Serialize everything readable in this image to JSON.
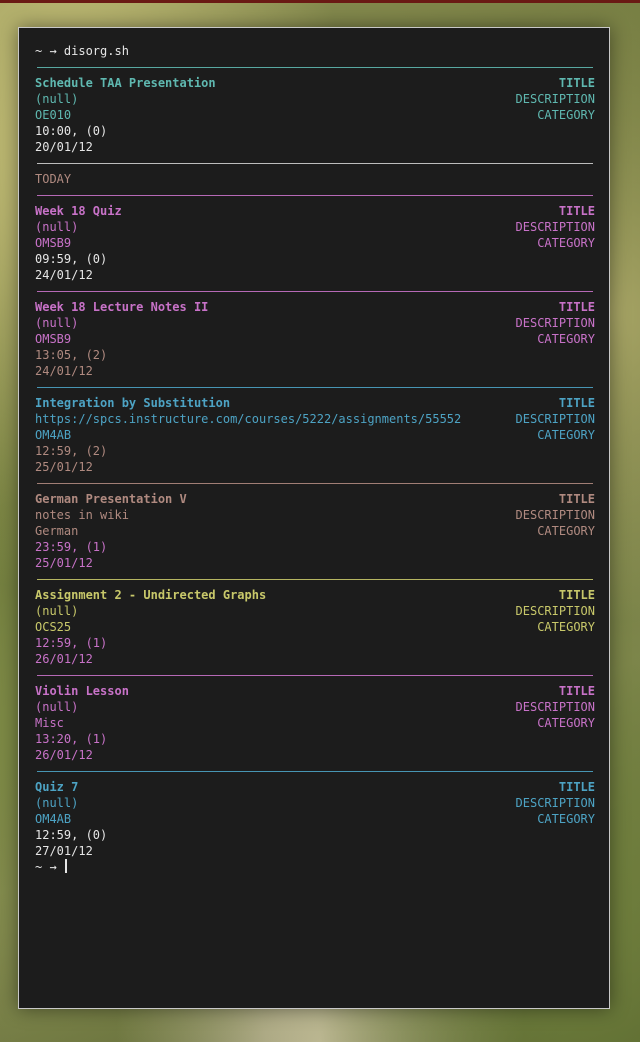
{
  "terminal": {
    "prompt": "~ → ",
    "command": "disorg.sh",
    "today_label": "TODAY",
    "labels": {
      "title": "TITLE",
      "description": "DESCRIPTION",
      "category": "CATEGORY"
    }
  },
  "colors": {
    "cyan": "#5fb8b0",
    "magenta": "#c872c8",
    "blue": "#4da3c4",
    "brown": "#b08a80",
    "yellow": "#c8c86a",
    "white": "#e6e6e6",
    "sep_gray": "#cfcfcf"
  },
  "entries": [
    {
      "title": "Schedule TAA Presentation",
      "description": "(null)",
      "category": "OE010",
      "time": "10:00, (0)",
      "date": "20/01/12"
    },
    {
      "title": "Week 18 Quiz",
      "description": "(null)",
      "category": "OMSB9",
      "time": "09:59, (0)",
      "date": "24/01/12"
    },
    {
      "title": "Week 18 Lecture Notes II",
      "description": "(null)",
      "category": "OMSB9",
      "time": "13:05, (2)",
      "date": "24/01/12"
    },
    {
      "title": "Integration by Substitution",
      "description": "https://spcs.instructure.com/courses/5222/assignments/55552",
      "category": "OM4AB",
      "time": "12:59, (2)",
      "date": "25/01/12"
    },
    {
      "title": "German Presentation V",
      "description": "notes in wiki",
      "category": "German",
      "time": "23:59, (1)",
      "date": "25/01/12"
    },
    {
      "title": "Assignment 2 - Undirected Graphs",
      "description": "(null)",
      "category": "OCS25",
      "time": "12:59, (1)",
      "date": "26/01/12"
    },
    {
      "title": "Violin Lesson",
      "description": "(null)",
      "category": "Misc",
      "time": "13:20, (1)",
      "date": "26/01/12"
    },
    {
      "title": "Quiz 7",
      "description": "(null)",
      "category": "OM4AB",
      "time": "12:59, (0)",
      "date": "27/01/12"
    }
  ]
}
